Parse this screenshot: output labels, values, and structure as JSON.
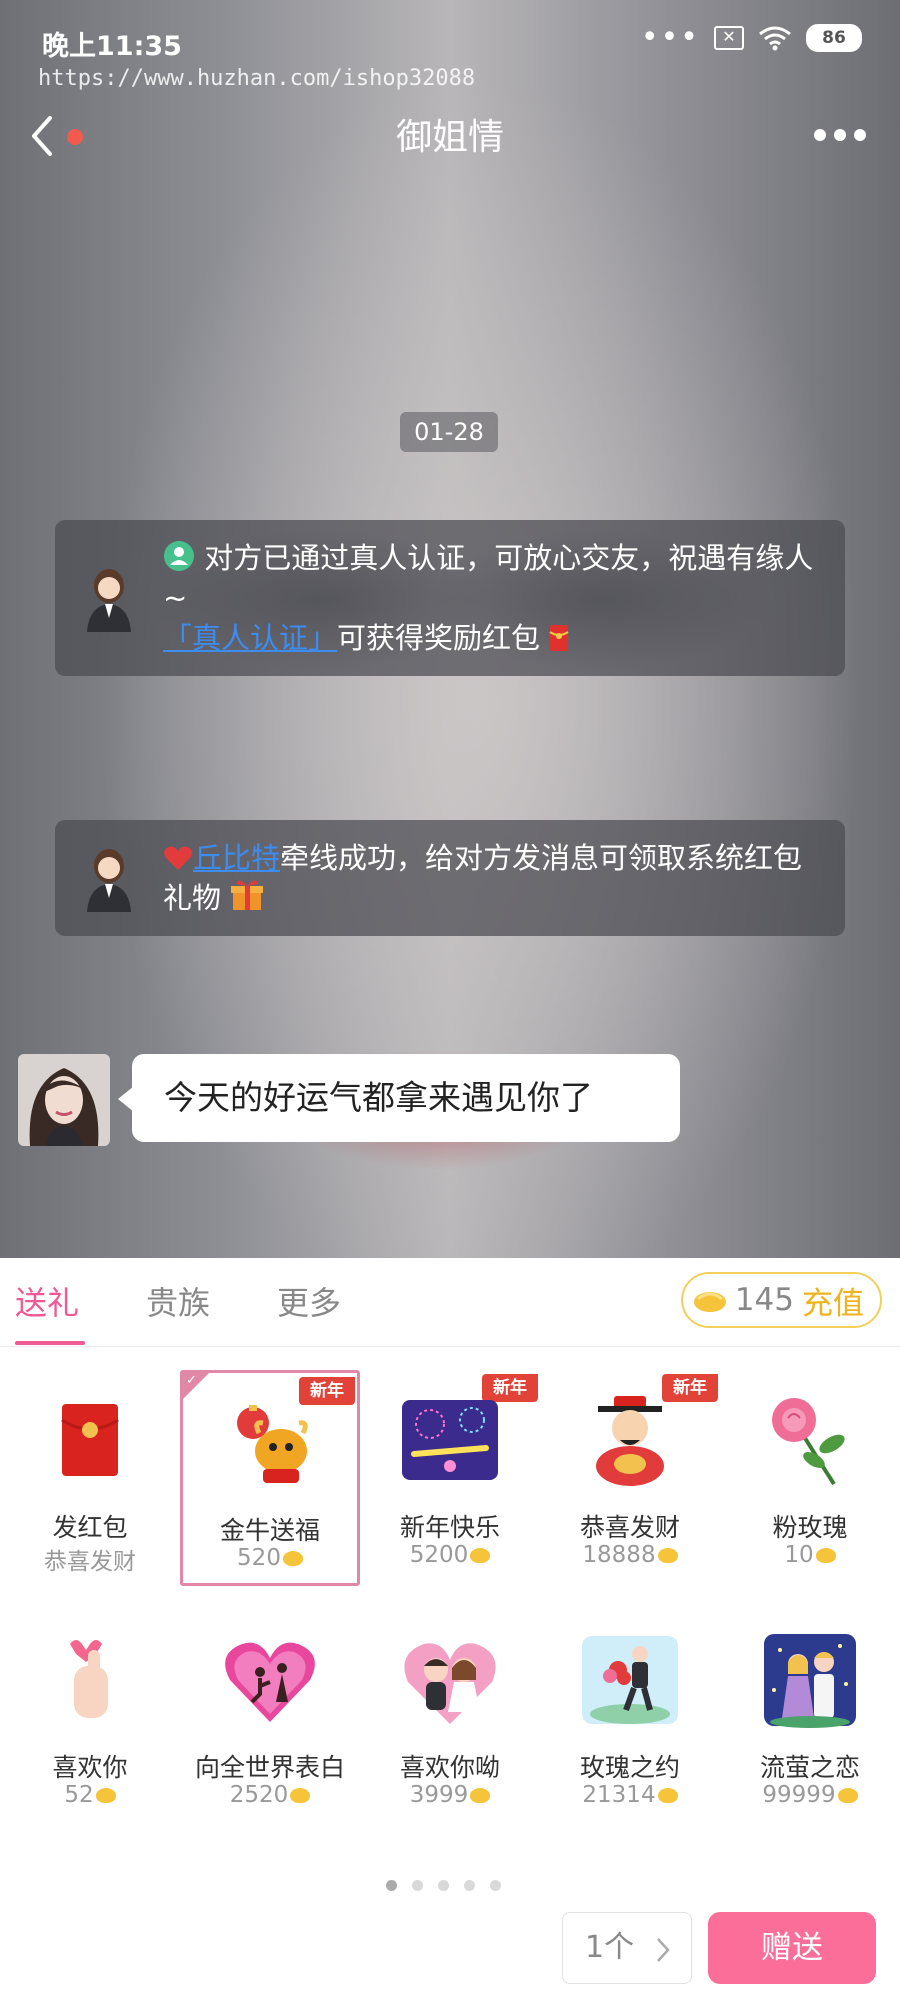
{
  "status_bar": {
    "time": "晚上11:35",
    "signal_dots": "•••",
    "battery": "86"
  },
  "watermark": "https://www.huzhan.com/ishop32088",
  "nav": {
    "title": "御姐情",
    "back_icon": "chevron-left-icon",
    "more_icon": "more-dots-icon"
  },
  "chat": {
    "date": "01-28",
    "system_messages": [
      {
        "text": "对方已通过真人认证，可放心交友，祝遇有缘人~",
        "link": "「真人认证」",
        "suffix": "可获得奖励红包"
      },
      {
        "link": "丘比特",
        "text": "牵线成功，给对方发消息可领取系统红包礼物"
      }
    ],
    "message": "今天的好运气都拿来遇见你了"
  },
  "gift_panel": {
    "tabs": [
      "送礼",
      "贵族",
      "更多"
    ],
    "active_tab": 0,
    "balance": "145",
    "recharge_label": "充值",
    "badge_label": "新年",
    "gifts": [
      {
        "name": "发红包",
        "price": "恭喜发财",
        "badge": false,
        "icon": "red-envelope-icon"
      },
      {
        "name": "金牛送福",
        "price": "520",
        "badge": true,
        "icon": "golden-ox-icon"
      },
      {
        "name": "新年快乐",
        "price": "5200",
        "badge": true,
        "icon": "fireworks-icon"
      },
      {
        "name": "恭喜发财",
        "price": "18888",
        "badge": true,
        "icon": "god-of-wealth-icon"
      },
      {
        "name": "粉玫瑰",
        "price": "10",
        "badge": false,
        "icon": "pink-rose-icon"
      },
      {
        "name": "喜欢你",
        "price": "52",
        "badge": false,
        "icon": "finger-heart-icon"
      },
      {
        "name": "向全世界表白",
        "price": "2520",
        "badge": false,
        "icon": "heart-proposal-icon"
      },
      {
        "name": "喜欢你呦",
        "price": "3999",
        "badge": false,
        "icon": "couple-heart-icon"
      },
      {
        "name": "玫瑰之约",
        "price": "21314",
        "badge": false,
        "icon": "rose-proposal-icon"
      },
      {
        "name": "流萤之恋",
        "price": "99999",
        "badge": false,
        "icon": "firefly-couple-icon"
      }
    ],
    "selected_gift": 1,
    "page_count": 5,
    "current_page": 1,
    "quantity": "1个",
    "send_label": "赠送"
  },
  "colors": {
    "accent": "#ef5a94",
    "send_button": "#fb6e9a",
    "recharge": "#efb31b",
    "badge": "#e14339",
    "link": "#3d8cf0"
  }
}
